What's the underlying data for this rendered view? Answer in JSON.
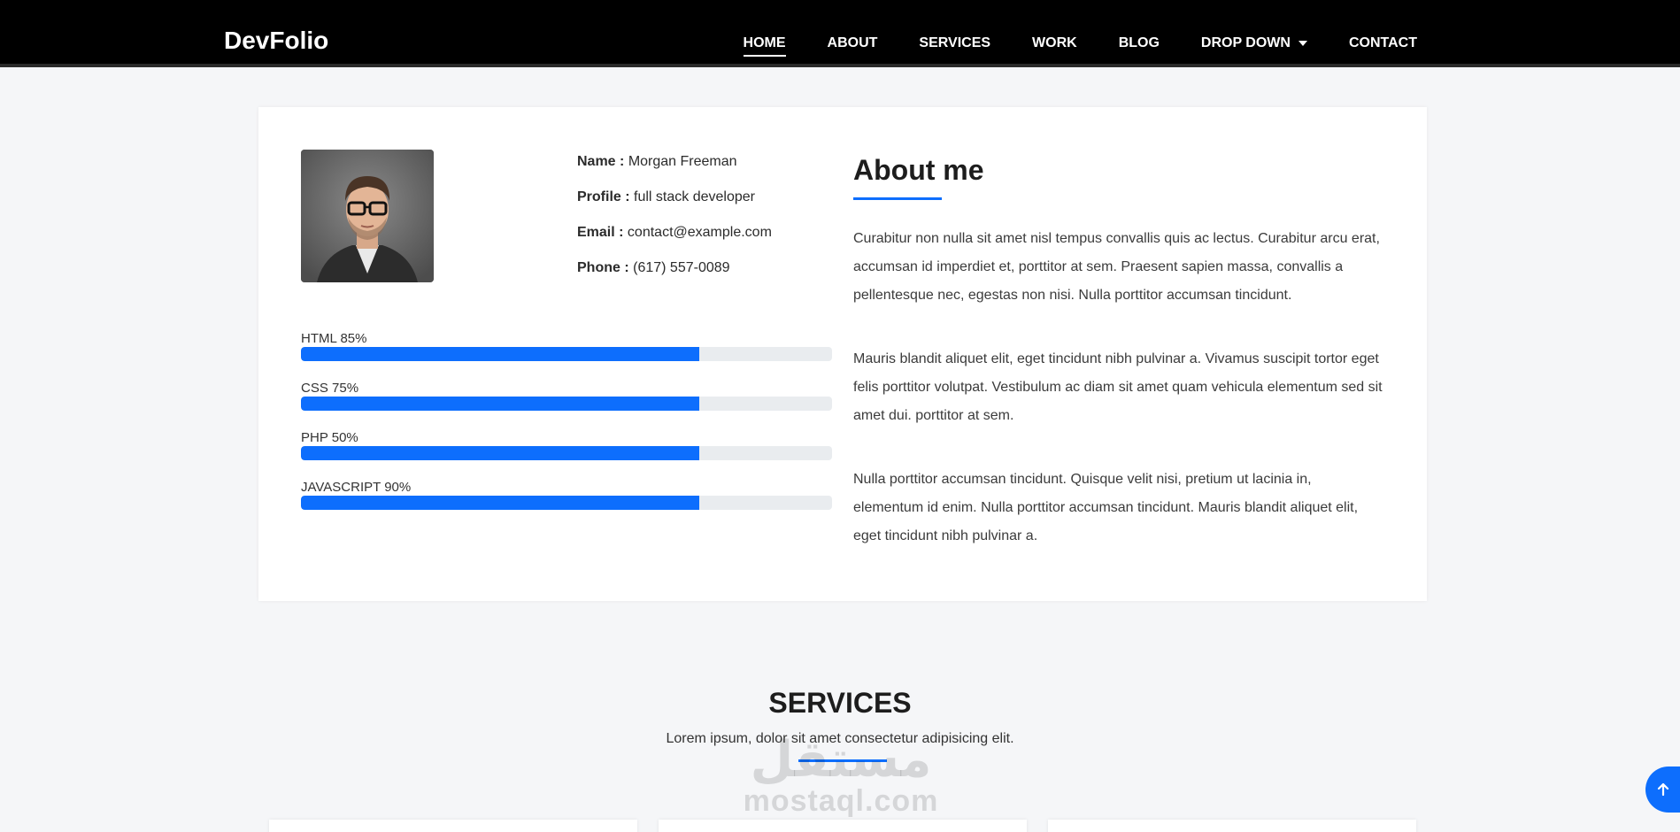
{
  "brand": "DevFolio",
  "nav": {
    "items": [
      {
        "label": "HOME",
        "active": true
      },
      {
        "label": "ABOUT"
      },
      {
        "label": "SERVICES"
      },
      {
        "label": "WORK"
      },
      {
        "label": "BLOG"
      },
      {
        "label": "DROP DOWN",
        "dropdown": true
      },
      {
        "label": "CONTACT"
      }
    ]
  },
  "profile": {
    "name_label": "Name :",
    "name": "Morgan Freeman",
    "profile_label": "Profile :",
    "profile": "full stack developer",
    "email_label": "Email :",
    "email": "contact@example.com",
    "phone_label": "Phone :",
    "phone": "(617) 557-0089"
  },
  "skills": [
    {
      "label": "HTML 85%",
      "fill": 0.75
    },
    {
      "label": "CSS 75%",
      "fill": 0.75
    },
    {
      "label": "PHP 50%",
      "fill": 0.75
    },
    {
      "label": "JAVASCRIPT 90%",
      "fill": 0.75
    }
  ],
  "about": {
    "title": "About me",
    "paragraphs": [
      "Curabitur non nulla sit amet nisl tempus convallis quis ac lectus. Curabitur arcu erat, accumsan id imperdiet et, porttitor at sem. Praesent sapien massa, convallis a pellentesque nec, egestas non nisi. Nulla porttitor accumsan tincidunt.",
      "Mauris blandit aliquet elit, eget tincidunt nibh pulvinar a. Vivamus suscipit tortor eget felis porttitor volutpat. Vestibulum ac diam sit amet quam vehicula elementum sed sit amet dui. porttitor at sem.",
      "Nulla porttitor accumsan tincidunt. Quisque velit nisi, pretium ut lacinia in, elementum id enim. Nulla porttitor accumsan tincidunt. Mauris blandit aliquet elit, eget tincidunt nibh pulvinar a."
    ]
  },
  "services": {
    "title": "SERVICES",
    "subtitle": "Lorem ipsum, dolor sit amet consectetur adipisicing elit."
  },
  "watermark": {
    "arabic": "مستقل",
    "latin": "mostaql.com"
  },
  "colors": {
    "accent": "#0d6efd",
    "navbar": "#000000",
    "background": "#f5f6f8"
  },
  "icons": {
    "back_to_top": "arrow-up-icon",
    "dropdown": "caret-down-icon"
  }
}
